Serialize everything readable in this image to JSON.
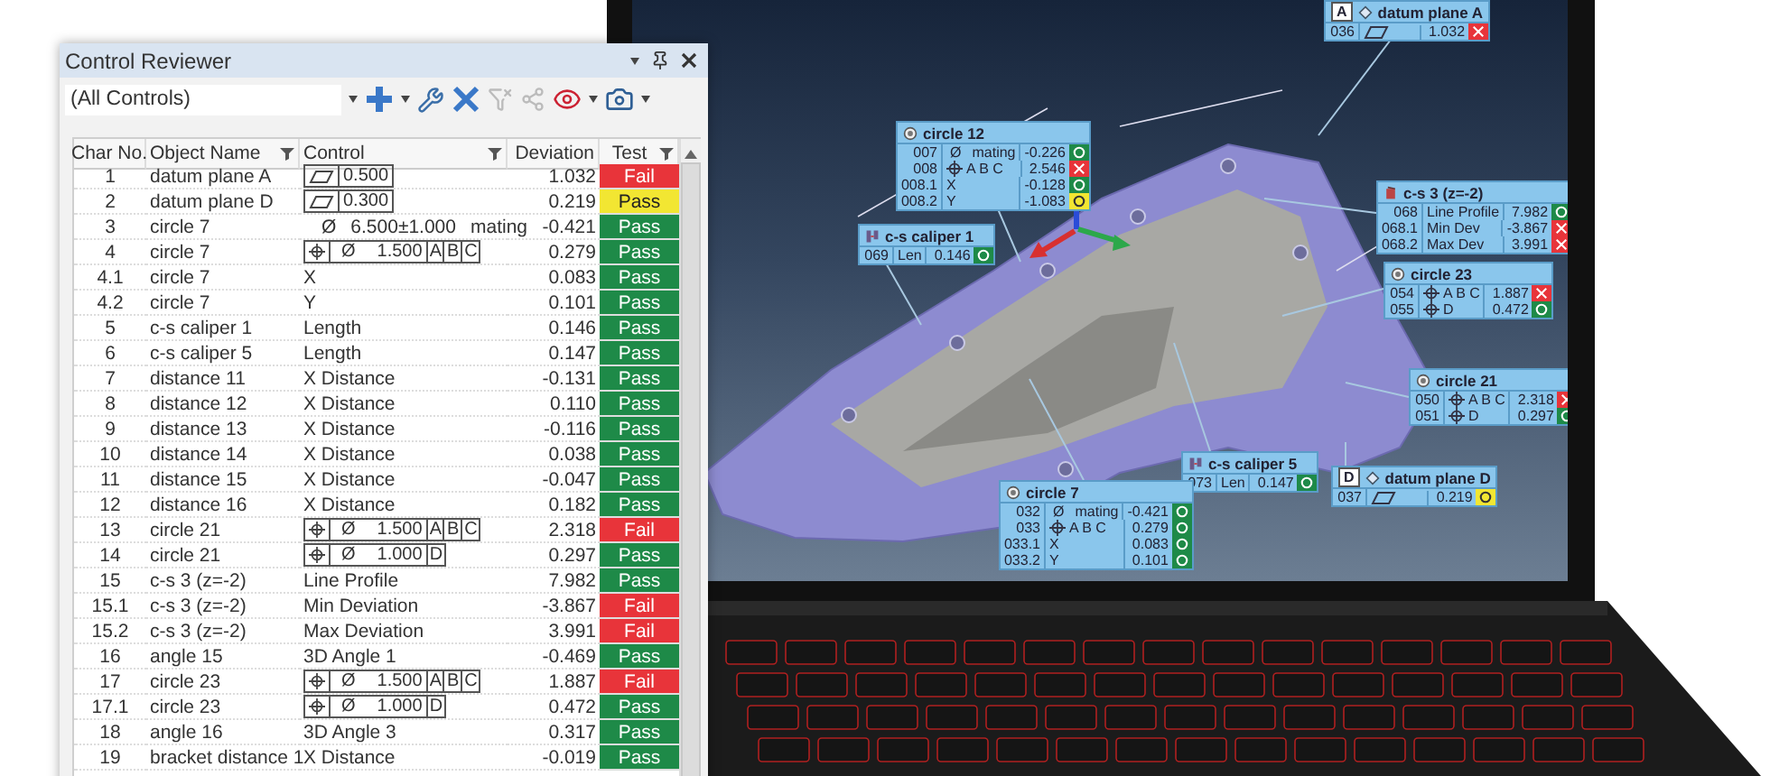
{
  "panel": {
    "title": "Control Reviewer",
    "filter": "(All Controls)"
  },
  "table": {
    "columns": [
      {
        "label": "Char No.",
        "filter": false
      },
      {
        "label": "Object Name",
        "filter": true
      },
      {
        "label": "Control",
        "filter": true
      },
      {
        "label": "Deviation",
        "filter": false
      },
      {
        "label": "Test",
        "filter": true
      }
    ],
    "rows": [
      {
        "char": "1",
        "object": "datum plane A",
        "control": {
          "kind": "flatness",
          "value": "0.500"
        },
        "deviation": "1.032",
        "test": {
          "text": "Fail",
          "kind": "fail"
        }
      },
      {
        "char": "2",
        "object": "datum plane D",
        "control": {
          "kind": "flatness",
          "value": "0.300"
        },
        "deviation": "0.219",
        "test": {
          "text": "Pass",
          "kind": "warning"
        }
      },
      {
        "char": "3",
        "object": "circle 7",
        "control": {
          "kind": "size",
          "sign": "Ø",
          "value": "6.500±1.000",
          "note": "mating"
        },
        "deviation": "-0.421",
        "test": {
          "text": "Pass",
          "kind": "pass"
        }
      },
      {
        "char": "4",
        "object": "circle 7",
        "control": {
          "kind": "position",
          "sign": "Ø",
          "value": "1.500",
          "datums": [
            "A",
            "B",
            "C"
          ]
        },
        "deviation": "0.279",
        "test": {
          "text": "Pass",
          "kind": "pass"
        }
      },
      {
        "char": "4.1",
        "object": "circle 7",
        "control": {
          "kind": "plain",
          "text": "X"
        },
        "deviation": "0.083",
        "test": {
          "text": "Pass",
          "kind": "pass"
        }
      },
      {
        "char": "4.2",
        "object": "circle 7",
        "control": {
          "kind": "plain",
          "text": "Y"
        },
        "deviation": "0.101",
        "test": {
          "text": "Pass",
          "kind": "pass"
        }
      },
      {
        "char": "5",
        "object": "c-s caliper 1",
        "control": {
          "kind": "plain",
          "text": "Length"
        },
        "deviation": "0.146",
        "test": {
          "text": "Pass",
          "kind": "pass"
        }
      },
      {
        "char": "6",
        "object": "c-s caliper 5",
        "control": {
          "kind": "plain",
          "text": "Length"
        },
        "deviation": "0.147",
        "test": {
          "text": "Pass",
          "kind": "pass"
        }
      },
      {
        "char": "7",
        "object": "distance 11",
        "control": {
          "kind": "plain",
          "text": "X Distance"
        },
        "deviation": "-0.131",
        "test": {
          "text": "Pass",
          "kind": "pass"
        }
      },
      {
        "char": "8",
        "object": "distance 12",
        "control": {
          "kind": "plain",
          "text": "X Distance"
        },
        "deviation": "0.110",
        "test": {
          "text": "Pass",
          "kind": "pass"
        }
      },
      {
        "char": "9",
        "object": "distance 13",
        "control": {
          "kind": "plain",
          "text": "X Distance"
        },
        "deviation": "-0.116",
        "test": {
          "text": "Pass",
          "kind": "pass"
        }
      },
      {
        "char": "10",
        "object": "distance 14",
        "control": {
          "kind": "plain",
          "text": "X Distance"
        },
        "deviation": "0.038",
        "test": {
          "text": "Pass",
          "kind": "pass"
        }
      },
      {
        "char": "11",
        "object": "distance 15",
        "control": {
          "kind": "plain",
          "text": "X Distance"
        },
        "deviation": "-0.047",
        "test": {
          "text": "Pass",
          "kind": "pass"
        }
      },
      {
        "char": "12",
        "object": "distance 16",
        "control": {
          "kind": "plain",
          "text": "X Distance"
        },
        "deviation": "0.182",
        "test": {
          "text": "Pass",
          "kind": "pass"
        }
      },
      {
        "char": "13",
        "object": "circle 21",
        "control": {
          "kind": "position",
          "sign": "Ø",
          "value": "1.500",
          "datums": [
            "A",
            "B",
            "C"
          ]
        },
        "deviation": "2.318",
        "test": {
          "text": "Fail",
          "kind": "fail"
        }
      },
      {
        "char": "14",
        "object": "circle 21",
        "control": {
          "kind": "position",
          "sign": "Ø",
          "value": "1.000",
          "datums": [
            "D"
          ]
        },
        "deviation": "0.297",
        "test": {
          "text": "Pass",
          "kind": "pass"
        }
      },
      {
        "char": "15",
        "object": "c-s 3 (z=-2)",
        "control": {
          "kind": "plain",
          "text": "Line Profile"
        },
        "deviation": "7.982",
        "test": {
          "text": "Pass",
          "kind": "pass"
        }
      },
      {
        "char": "15.1",
        "object": "c-s 3 (z=-2)",
        "control": {
          "kind": "plain",
          "text": "Min Deviation"
        },
        "deviation": "-3.867",
        "test": {
          "text": "Fail",
          "kind": "fail"
        }
      },
      {
        "char": "15.2",
        "object": "c-s 3 (z=-2)",
        "control": {
          "kind": "plain",
          "text": "Max Deviation"
        },
        "deviation": "3.991",
        "test": {
          "text": "Fail",
          "kind": "fail"
        }
      },
      {
        "char": "16",
        "object": "angle 15",
        "control": {
          "kind": "plain",
          "text": "3D Angle 1"
        },
        "deviation": "-0.469",
        "test": {
          "text": "Pass",
          "kind": "pass"
        }
      },
      {
        "char": "17",
        "object": "circle 23",
        "control": {
          "kind": "position",
          "sign": "Ø",
          "value": "1.500",
          "datums": [
            "A",
            "B",
            "C"
          ]
        },
        "deviation": "1.887",
        "test": {
          "text": "Fail",
          "kind": "fail"
        }
      },
      {
        "char": "17.1",
        "object": "circle 23",
        "control": {
          "kind": "position",
          "sign": "Ø",
          "value": "1.000",
          "datums": [
            "D"
          ]
        },
        "deviation": "0.472",
        "test": {
          "text": "Pass",
          "kind": "pass"
        }
      },
      {
        "char": "18",
        "object": "angle 16",
        "control": {
          "kind": "plain",
          "text": "3D Angle 3"
        },
        "deviation": "0.317",
        "test": {
          "text": "Pass",
          "kind": "pass"
        }
      },
      {
        "char": "19",
        "object": "bracket distance 1",
        "control": {
          "kind": "plain",
          "text": "X Distance"
        },
        "deviation": "-0.019",
        "test": {
          "text": "Pass",
          "kind": "pass"
        }
      }
    ]
  },
  "callouts": [
    {
      "kind": "datum",
      "letter": "A",
      "title": "datum plane A",
      "rows": [
        {
          "id": "036",
          "kind": "flatness",
          "value": "1.032",
          "result": {
            "kind": "fail"
          }
        }
      ]
    },
    {
      "kind": "circle",
      "title": "circle 12",
      "rows": [
        {
          "id": "007",
          "kind": "plain",
          "sign": "Ø",
          "label": "mating",
          "value": "-0.226",
          "result": {
            "kind": "pass"
          }
        },
        {
          "id": "008",
          "kind": "position",
          "label": "A B C",
          "value": "2.546",
          "result": {
            "kind": "fail"
          }
        },
        {
          "id": "008.1",
          "kind": "plain",
          "label": "X",
          "value": "-0.128",
          "result": {
            "kind": "pass"
          }
        },
        {
          "id": "008.2",
          "kind": "plain",
          "label": "Y",
          "value": "-1.083",
          "result": {
            "kind": "warning"
          }
        }
      ]
    },
    {
      "kind": "caliper",
      "title": "c-s caliper 1",
      "rows": [
        {
          "id": "069",
          "kind": "plain",
          "label": "Len",
          "value": "0.146",
          "result": {
            "kind": "pass"
          }
        }
      ]
    },
    {
      "kind": "section",
      "title": "c-s 3 (z=-2)",
      "rows": [
        {
          "id": "068",
          "kind": "plain",
          "label": "Line Profile",
          "value": "7.982",
          "result": {
            "kind": "pass"
          }
        },
        {
          "id": "068.1",
          "kind": "plain",
          "label": "Min Dev",
          "value": "-3.867",
          "result": {
            "kind": "fail"
          }
        },
        {
          "id": "068.2",
          "kind": "plain",
          "label": "Max Dev",
          "value": "3.991",
          "result": {
            "kind": "fail"
          }
        }
      ]
    },
    {
      "kind": "circle",
      "title": "circle 23",
      "rows": [
        {
          "id": "054",
          "kind": "position",
          "label": "A B C",
          "value": "1.887",
          "result": {
            "kind": "fail"
          }
        },
        {
          "id": "055",
          "kind": "position",
          "label": "D",
          "value": "0.472",
          "result": {
            "kind": "pass"
          }
        }
      ]
    },
    {
      "kind": "circle",
      "title": "circle 21",
      "rows": [
        {
          "id": "050",
          "kind": "position",
          "label": "A B C",
          "value": "2.318",
          "result": {
            "kind": "fail"
          }
        },
        {
          "id": "051",
          "kind": "position",
          "label": "D",
          "value": "0.297",
          "result": {
            "kind": "pass"
          }
        }
      ]
    },
    {
      "kind": "caliper",
      "title": "c-s caliper 5",
      "rows": [
        {
          "id": "073",
          "kind": "plain",
          "label": "Len",
          "value": "0.147",
          "result": {
            "kind": "pass"
          }
        }
      ]
    },
    {
      "kind": "datum",
      "letter": "D",
      "title": "datum plane D",
      "rows": [
        {
          "id": "037",
          "kind": "flatness",
          "value": "0.219",
          "result": {
            "kind": "warning"
          }
        }
      ]
    },
    {
      "kind": "circle",
      "title": "circle 7",
      "rows": [
        {
          "id": "032",
          "kind": "plain",
          "sign": "Ø",
          "label": "mating",
          "value": "-0.421",
          "result": {
            "kind": "pass"
          }
        },
        {
          "id": "033",
          "kind": "position",
          "label": "A B C",
          "value": "0.279",
          "result": {
            "kind": "pass"
          }
        },
        {
          "id": "033.1",
          "kind": "plain",
          "label": "X",
          "value": "0.083",
          "result": {
            "kind": "pass"
          }
        },
        {
          "id": "033.2",
          "kind": "plain",
          "label": "Y",
          "value": "0.101",
          "result": {
            "kind": "pass"
          }
        }
      ]
    }
  ]
}
